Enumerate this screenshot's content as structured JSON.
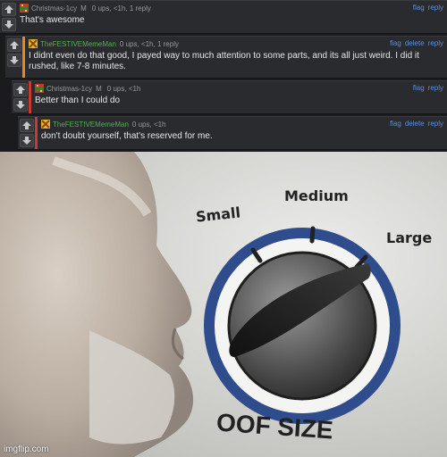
{
  "comments": [
    {
      "user": "Christmas-1cy",
      "badge": "M",
      "stats": "0 ups, <1h, 1 reply",
      "text": "That's awesome",
      "actions": [
        "flag",
        "reply"
      ]
    },
    {
      "user": "TheFESTIVEMemeMan",
      "badge": "",
      "stats": "0 ups, <1h, 1 reply",
      "text": "I didnt even do that good, I payed way to much attention to some parts, and its all just weird. I did it rushed, like 7-8 minutes.",
      "actions": [
        "flag",
        "delete",
        "reply"
      ]
    },
    {
      "user": "Christmas-1cy",
      "badge": "M",
      "stats": "0 ups, <1h",
      "text": "Better than I could do",
      "actions": [
        "flag",
        "reply"
      ]
    },
    {
      "user": "TheFESTIVEMemeMan",
      "badge": "",
      "stats": "0 ups, <1h",
      "text": "don't doubt yourself, that's reserved for me.",
      "actions": [
        "flag",
        "delete",
        "reply"
      ]
    }
  ],
  "meme": {
    "labels": {
      "small": "Small",
      "medium": "Medium",
      "large": "Large",
      "caption": "OOF SIZE"
    },
    "watermark": "imgflip.com"
  },
  "colors": {
    "stripe_orange": "#e48a1c",
    "stripe_red": "#c93a32",
    "link": "#5b8fd8",
    "user_green": "#4fb34f",
    "dial_blue": "#2f4c8c"
  }
}
